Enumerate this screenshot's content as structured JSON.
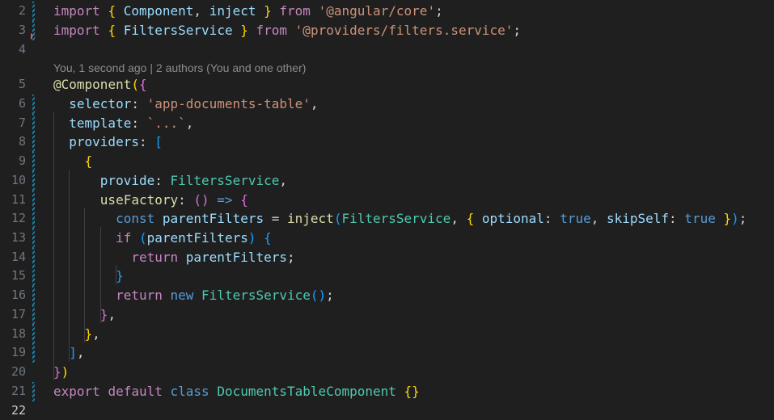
{
  "editor": {
    "codelens": "You, 1 second ago | 2 authors (You and one other)",
    "lines": [
      {
        "num": "2",
        "tokens": [
          [
            "kw-ctrl",
            "import"
          ],
          [
            "pun",
            " "
          ],
          [
            "b1",
            "{"
          ],
          [
            "pun",
            " "
          ],
          [
            "var",
            "Component"
          ],
          [
            "pun",
            ", "
          ],
          [
            "var",
            "inject"
          ],
          [
            "pun",
            " "
          ],
          [
            "b1",
            "}"
          ],
          [
            "pun",
            " "
          ],
          [
            "kw-ctrl",
            "from"
          ],
          [
            "pun",
            " "
          ],
          [
            "str",
            "'@angular/core'"
          ],
          [
            "pun",
            ";"
          ]
        ]
      },
      {
        "num": "3",
        "tokens": [
          [
            "kw-ctrl",
            "import"
          ],
          [
            "pun",
            " "
          ],
          [
            "b1",
            "{"
          ],
          [
            "pun",
            " "
          ],
          [
            "var",
            "FiltersService"
          ],
          [
            "pun",
            " "
          ],
          [
            "b1",
            "}"
          ],
          [
            "pun",
            " "
          ],
          [
            "kw-ctrl",
            "from"
          ],
          [
            "pun",
            " "
          ],
          [
            "str",
            "'@providers/filters.service'"
          ],
          [
            "pun",
            ";"
          ]
        ]
      },
      {
        "num": "4",
        "tokens": []
      },
      {
        "num": "5",
        "tokens": [
          [
            "fn",
            "@"
          ],
          [
            "fn",
            "Component"
          ],
          [
            "b1",
            "("
          ],
          [
            "b2",
            "{"
          ]
        ]
      },
      {
        "num": "6",
        "tokens": [
          [
            "pun",
            "  "
          ],
          [
            "prop",
            "selector"
          ],
          [
            "pun",
            ": "
          ],
          [
            "str",
            "'app-documents-table'"
          ],
          [
            "pun",
            ","
          ]
        ]
      },
      {
        "num": "7",
        "tokens": [
          [
            "pun",
            "  "
          ],
          [
            "prop",
            "template"
          ],
          [
            "pun",
            ": "
          ],
          [
            "str",
            "`...`"
          ],
          [
            "pun",
            ","
          ]
        ]
      },
      {
        "num": "8",
        "tokens": [
          [
            "pun",
            "  "
          ],
          [
            "prop",
            "providers"
          ],
          [
            "pun",
            ": "
          ],
          [
            "b3",
            "["
          ]
        ]
      },
      {
        "num": "9",
        "tokens": [
          [
            "pun",
            "    "
          ],
          [
            "b1",
            "{"
          ]
        ]
      },
      {
        "num": "10",
        "tokens": [
          [
            "pun",
            "      "
          ],
          [
            "prop",
            "provide"
          ],
          [
            "pun",
            ": "
          ],
          [
            "ty",
            "FiltersService"
          ],
          [
            "pun",
            ","
          ]
        ]
      },
      {
        "num": "11",
        "tokens": [
          [
            "pun",
            "      "
          ],
          [
            "fn",
            "useFactory"
          ],
          [
            "pun",
            ": "
          ],
          [
            "b2",
            "()"
          ],
          [
            "pun",
            " "
          ],
          [
            "kw",
            "=>"
          ],
          [
            "pun",
            " "
          ],
          [
            "b2",
            "{"
          ]
        ]
      },
      {
        "num": "12",
        "tokens": [
          [
            "pun",
            "        "
          ],
          [
            "kw",
            "const"
          ],
          [
            "pun",
            " "
          ],
          [
            "var",
            "parentFilters"
          ],
          [
            "pun",
            " = "
          ],
          [
            "fn",
            "inject"
          ],
          [
            "b3",
            "("
          ],
          [
            "ty",
            "FiltersService"
          ],
          [
            "pun",
            ", "
          ],
          [
            "b1",
            "{"
          ],
          [
            "pun",
            " "
          ],
          [
            "prop",
            "optional"
          ],
          [
            "pun",
            ": "
          ],
          [
            "kw",
            "true"
          ],
          [
            "pun",
            ", "
          ],
          [
            "prop",
            "skipSelf"
          ],
          [
            "pun",
            ": "
          ],
          [
            "kw",
            "true"
          ],
          [
            "pun",
            " "
          ],
          [
            "b1",
            "}"
          ],
          [
            "b3",
            ")"
          ],
          [
            "pun",
            ";"
          ]
        ]
      },
      {
        "num": "13",
        "tokens": [
          [
            "pun",
            "        "
          ],
          [
            "kw-ctrl",
            "if"
          ],
          [
            "pun",
            " "
          ],
          [
            "b3",
            "("
          ],
          [
            "var",
            "parentFilters"
          ],
          [
            "b3",
            ")"
          ],
          [
            "pun",
            " "
          ],
          [
            "b3",
            "{"
          ]
        ]
      },
      {
        "num": "14",
        "tokens": [
          [
            "pun",
            "          "
          ],
          [
            "kw-ctrl",
            "return"
          ],
          [
            "pun",
            " "
          ],
          [
            "var",
            "parentFilters"
          ],
          [
            "pun",
            ";"
          ]
        ]
      },
      {
        "num": "15",
        "tokens": [
          [
            "pun",
            "        "
          ],
          [
            "b3",
            "}"
          ]
        ]
      },
      {
        "num": "16",
        "tokens": [
          [
            "pun",
            "        "
          ],
          [
            "kw-ctrl",
            "return"
          ],
          [
            "pun",
            " "
          ],
          [
            "kw",
            "new"
          ],
          [
            "pun",
            " "
          ],
          [
            "ty",
            "FiltersService"
          ],
          [
            "b3",
            "()"
          ],
          [
            "pun",
            ";"
          ]
        ]
      },
      {
        "num": "17",
        "tokens": [
          [
            "pun",
            "      "
          ],
          [
            "b2",
            "}"
          ],
          [
            "pun",
            ","
          ]
        ]
      },
      {
        "num": "18",
        "tokens": [
          [
            "pun",
            "    "
          ],
          [
            "b1",
            "}"
          ],
          [
            "pun",
            ","
          ]
        ]
      },
      {
        "num": "19",
        "tokens": [
          [
            "pun",
            "  "
          ],
          [
            "b3",
            "]"
          ],
          [
            "pun",
            ","
          ]
        ]
      },
      {
        "num": "20",
        "tokens": [
          [
            "b2",
            "}"
          ],
          [
            "b1",
            ")"
          ]
        ]
      },
      {
        "num": "21",
        "tokens": [
          [
            "kw-ctrl",
            "export"
          ],
          [
            "pun",
            " "
          ],
          [
            "kw-ctrl",
            "default"
          ],
          [
            "pun",
            " "
          ],
          [
            "kw",
            "class"
          ],
          [
            "pun",
            " "
          ],
          [
            "ty",
            "DocumentsTableComponent"
          ],
          [
            "pun",
            " "
          ],
          [
            "b1",
            "{}"
          ]
        ]
      },
      {
        "num": "22",
        "tokens": []
      }
    ]
  }
}
